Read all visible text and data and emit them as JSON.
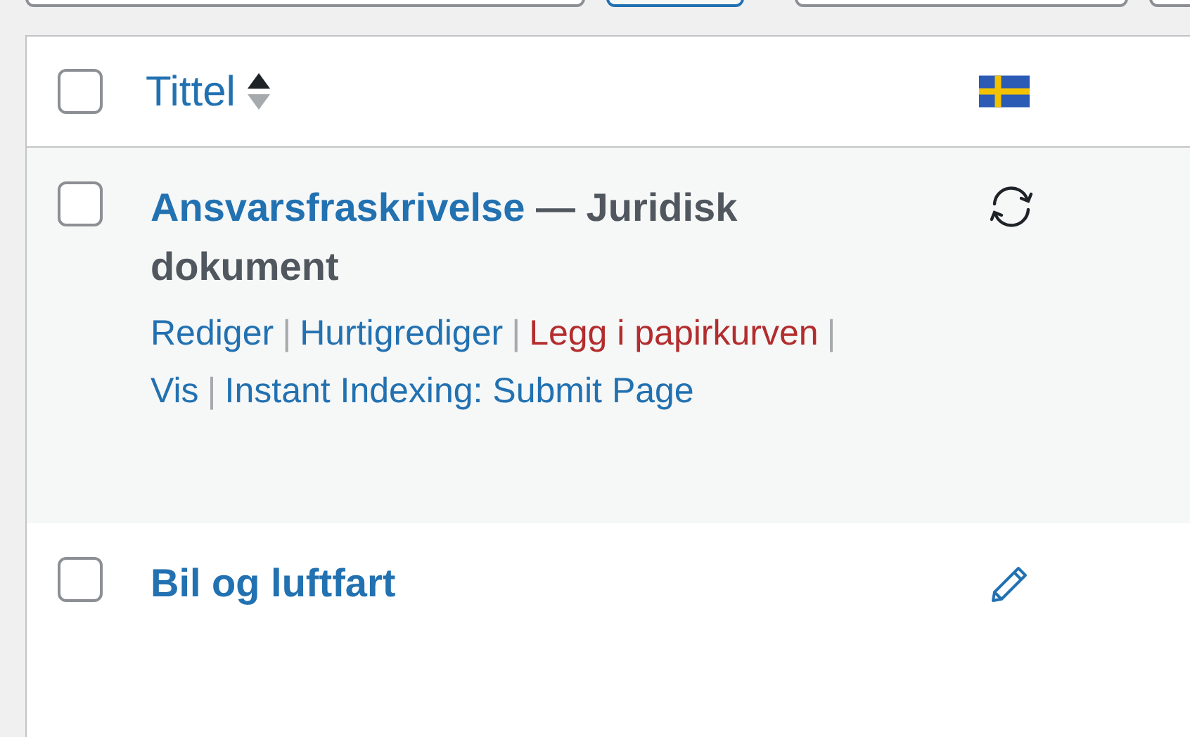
{
  "table": {
    "all_selected": false,
    "columns": [
      {
        "label": "Tittel",
        "sorted": true
      },
      {
        "kind": "flag"
      }
    ],
    "rows": [
      {
        "title": "Ansvarsfraskrivelse",
        "post_state": "— Juridisk dokument",
        "hovered": true,
        "selected": false,
        "kind": "sync",
        "actions": [
          {
            "label": "Rediger",
            "kind": "link"
          },
          {
            "label": "Hurtigrediger",
            "kind": "link"
          },
          {
            "label": "Legg i papirkurven",
            "kind": "delete"
          },
          {
            "label": "Vis",
            "kind": "link"
          },
          {
            "label": "Instant Indexing: Submit Page",
            "kind": "link"
          }
        ]
      },
      {
        "title": "Bil og luftfart",
        "hovered": false,
        "selected": false,
        "kind": "edit"
      }
    ],
    "separator": "|"
  }
}
